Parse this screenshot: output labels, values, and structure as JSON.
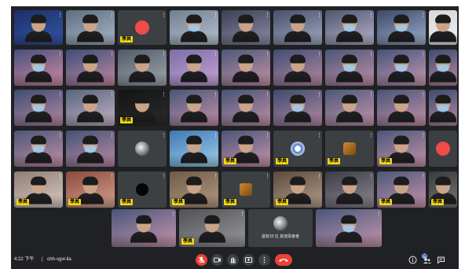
{
  "meeting": {
    "time": "4:22 下午",
    "separator": "|",
    "code": "ohh-sgvi-lla"
  },
  "participant_label": "學員",
  "tile_caption": "還有33 位 其他與會者",
  "tile_menu_glyph": "⋮",
  "controls": {
    "mic_icon": "mic-off-icon",
    "camera_icon": "camera-off-icon",
    "hand_icon": "raise-hand-icon",
    "present_icon": "present-icon",
    "more_icon": "more-options-icon",
    "end_icon": "end-call-icon",
    "info_icon": "info-icon",
    "people_icon": "people-icon",
    "chat_icon": "chat-icon",
    "people_count": "58"
  },
  "colors": {
    "background": "#202124",
    "tile": "#3c4043",
    "label": "#f5d90a",
    "end_call": "#ea4335"
  }
}
